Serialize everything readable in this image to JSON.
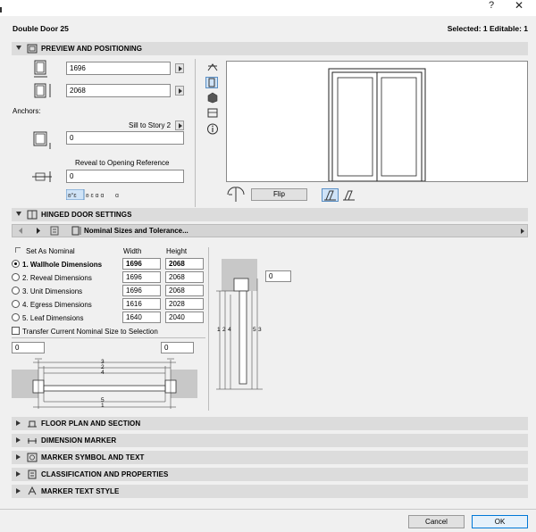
{
  "window": {
    "help": "?",
    "title": "Double Door 25",
    "selection_info": "Selected: 1 Editable: 1"
  },
  "preview_positioning": {
    "header": "PREVIEW AND POSITIONING",
    "width_value": "1696",
    "height_value": "2068",
    "anchors_label": "Anchors:",
    "sill_label": "Sill to Story 2",
    "sill_value": "0",
    "reveal_label": "Reveal to Opening Reference",
    "reveal_value": "0",
    "flip_label": "Flip"
  },
  "hinged_door": {
    "header": "HINGED DOOR SETTINGS",
    "page_selector": "Nominal Sizes and Tolerance...",
    "set_as_nominal": "Set As Nominal",
    "col_width": "Width",
    "col_height": "Height",
    "rows": [
      {
        "label": "1. Wallhole Dimensions",
        "width": "1696",
        "height": "2068",
        "selected": true
      },
      {
        "label": "2. Reveal Dimensions",
        "width": "1696",
        "height": "2068",
        "selected": false
      },
      {
        "label": "3. Unit Dimensions",
        "width": "1696",
        "height": "2068",
        "selected": false
      },
      {
        "label": "4. Egress Dimensions",
        "width": "1616",
        "height": "2028",
        "selected": false
      },
      {
        "label": "5. Leaf Dimensions",
        "width": "1640",
        "height": "2040",
        "selected": false
      }
    ],
    "transfer_label": "Transfer Current Nominal Size to Selection",
    "left_tolerance": "0",
    "right_tolerance": "0",
    "top_tolerance": "0",
    "plan_dim_labels": [
      "3",
      "2",
      "4",
      "5",
      "1"
    ],
    "section_dim_labels": [
      "1",
      "2",
      "4",
      "5",
      "3"
    ]
  },
  "collapsed_sections": [
    {
      "label": "FLOOR PLAN AND SECTION"
    },
    {
      "label": "DIMENSION MARKER"
    },
    {
      "label": "MARKER SYMBOL AND TEXT"
    },
    {
      "label": "CLASSIFICATION AND PROPERTIES"
    },
    {
      "label": "MARKER TEXT STYLE"
    }
  ],
  "footer": {
    "cancel_label": "Cancel",
    "ok_label": "OK"
  },
  "colors": {
    "section_bg": "#dcdcdc",
    "selected_blue": "#cfe3f7",
    "ok_border": "#0078d7"
  }
}
